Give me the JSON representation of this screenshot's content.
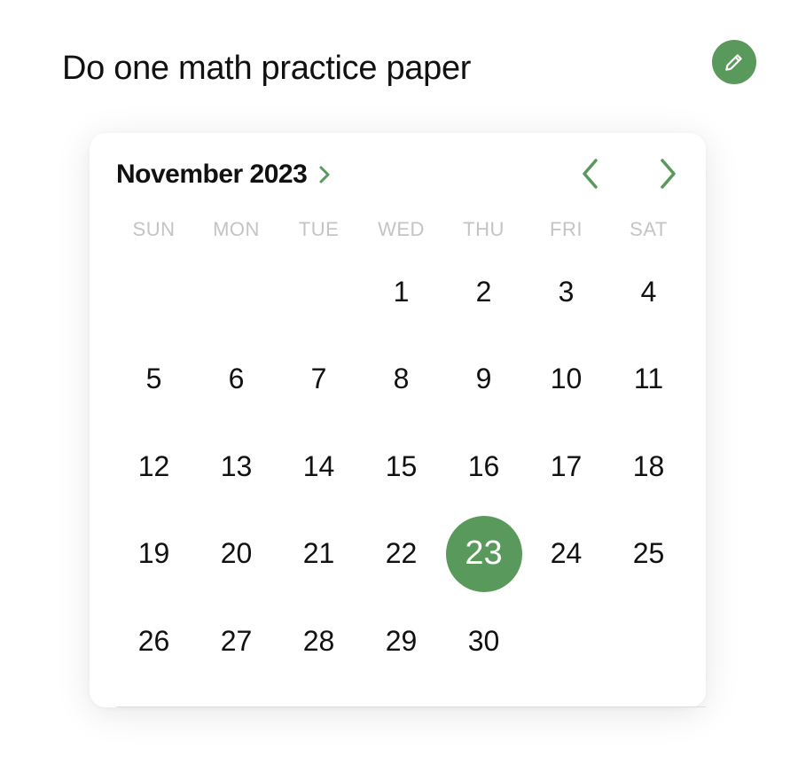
{
  "task": {
    "title": "Do one math practice paper"
  },
  "icons": {
    "edit": "pencil-icon",
    "month_toggle": "chevron-right-icon",
    "prev": "chevron-left-icon",
    "next": "chevron-right-icon"
  },
  "colors": {
    "accent": "#599a5c",
    "text": "#111111",
    "weekday": "#c4c4c4"
  },
  "calendar": {
    "month_label": "November 2023",
    "weekdays": [
      "SUN",
      "MON",
      "TUE",
      "WED",
      "THU",
      "FRI",
      "SAT"
    ],
    "first_weekday_index": 3,
    "days_in_month": 30,
    "selected_day": 23
  }
}
